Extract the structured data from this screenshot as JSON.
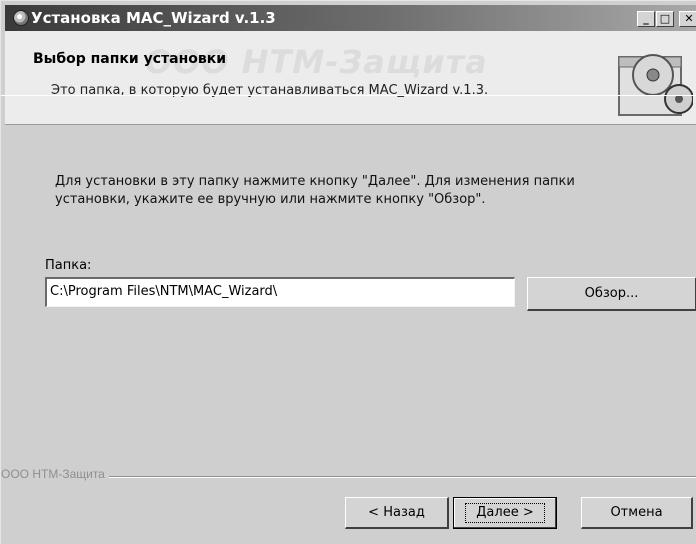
{
  "window": {
    "title": "Установка MAC_Wizard v.1.3",
    "controls": {
      "minimize": "_",
      "maximize": "□",
      "close": "✕"
    }
  },
  "header": {
    "title": "Выбор папки установки",
    "subtitle": "Это папка, в которую будет устанавливаться MAC_Wizard v.1.3.",
    "watermark": "ООО НТМ-Защита",
    "graphic_icon": "cd-installer-icon"
  },
  "body": {
    "instruction": "Для установки в эту папку нажмите кнопку \"Далее\". Для изменения папки установки, укажите ее вручную или нажмите кнопку \"Обзор\".",
    "folder_label": "Папка:",
    "folder_value": "C:\\Program Files\\NTM\\MAC_Wizard\\",
    "browse_label": "Обзор..."
  },
  "footer": {
    "company": "ООО НТМ-Защита",
    "back_label": "< Назад",
    "next_label": "Далее >",
    "cancel_label": "Отмена"
  },
  "colors": {
    "titlebar_start": "#3a3a3a",
    "titlebar_end": "#a9a9a9",
    "dialog_bg": "#cfcfcf",
    "header_bg": "#ececec"
  }
}
